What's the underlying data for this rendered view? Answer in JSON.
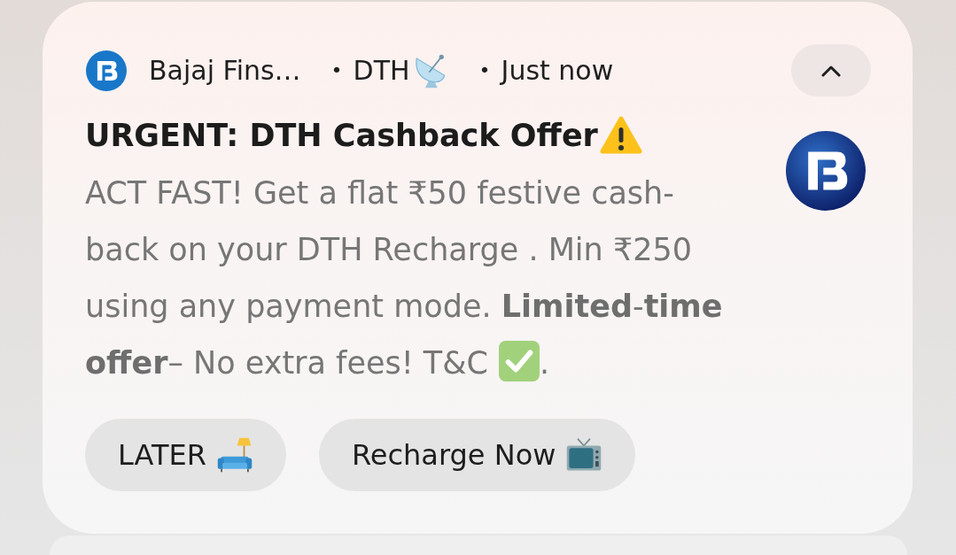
{
  "notification": {
    "app_name": "Bajaj Fins…",
    "meta": [
      {
        "kind": "channel",
        "separator": "•",
        "text": "DTH"
      },
      {
        "kind": "time",
        "separator": "•",
        "text": "Just now"
      }
    ],
    "expanded": true,
    "title": "URGENT: DTH Cashback Offer",
    "body": "ACT FAST! Get a flat ₹50 festive cash-back on your DTH Recharge . Min ₹250 using any payment mode. **Limited**-**time offer**– No extra fees! T&C",
    "body_end": ".",
    "actions": [
      {
        "kind": "later",
        "label": "LATER"
      },
      {
        "kind": "recharge",
        "label": "Recharge Now"
      }
    ]
  }
}
